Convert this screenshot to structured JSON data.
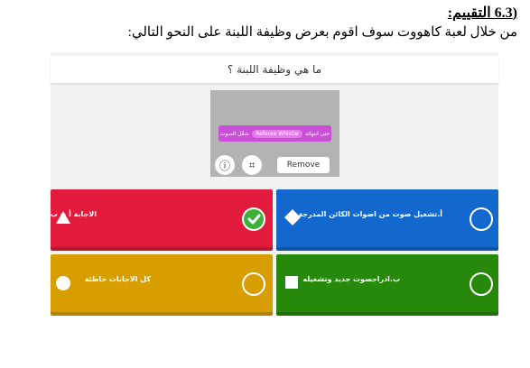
{
  "document": {
    "heading": "(6.3 التقييم:",
    "instruction": "من خلال لعبة كاهووت سوف اقوم بعرض وظيفة اللبنة على النحو التالي:"
  },
  "question": {
    "text": "ما هي وظيفة اللبنة ؟"
  },
  "media": {
    "block_left": "حتى انتهائه",
    "block_middle": "Referee Whistle",
    "block_right": "شغّل الصوت",
    "info_icon": "ⓘ",
    "crop_icon": "⌗",
    "remove_label": "Remove"
  },
  "answers": [
    {
      "label": "الاجابة أ + ب صحيحة",
      "shape": "triangle",
      "color": "#e21b3c",
      "correct": true
    },
    {
      "label": "أ.تشغيل صوت من اصوات الكائن المدرجة",
      "shape": "diamond",
      "color": "#1368ce",
      "correct": false
    },
    {
      "label": "كل الاجابات خاطئة",
      "shape": "circle",
      "color": "#d89e00",
      "correct": false
    },
    {
      "label": "ب.ادراجصوت جديد وتشغيله",
      "shape": "square",
      "color": "#26890c",
      "correct": false
    }
  ],
  "icons": {
    "check": "✓"
  }
}
